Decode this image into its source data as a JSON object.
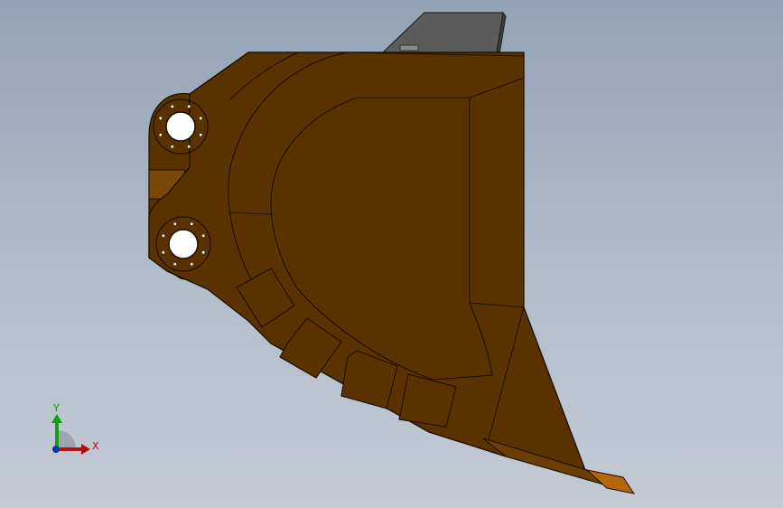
{
  "axes": {
    "x_label": "X",
    "y_label": "Y",
    "x_color": "#b01010",
    "y_color": "#10a010",
    "z_color": "#1030b0"
  },
  "colors": {
    "body": "#5a3200",
    "body_light": "#7a4806",
    "edge": "#1a0e00",
    "lip_plate": "#b8650f",
    "bracket": "#5c5c5c",
    "bolt": "#ffffff"
  }
}
